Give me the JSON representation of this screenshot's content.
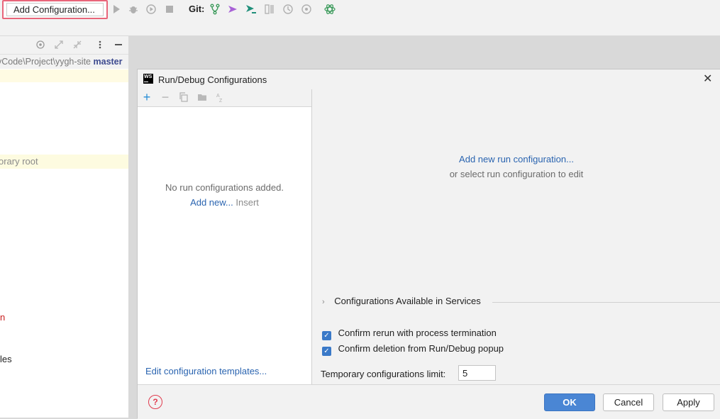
{
  "toolbar": {
    "add_configuration_label": "Add Configuration...",
    "git_label": "Git:"
  },
  "project_panel": {
    "path_prefix": "yCode\\Project\\yygh-site",
    "branch": "master",
    "highlight_text": "orary root",
    "row_text": "les",
    "red_text": "n"
  },
  "dialog": {
    "title": "Run/Debug Configurations",
    "logo_text": "WS",
    "close_label": "✕",
    "list": {
      "empty_text": "No run configurations added.",
      "add_new_link": "Add new...",
      "add_new_hint": "Insert",
      "edit_templates_link": "Edit configuration templates..."
    },
    "details": {
      "add_run_link": "Add new run configuration...",
      "or_select_text": "or select run configuration to edit",
      "services_label": "Configurations Available in Services",
      "confirm_rerun_label": "Confirm rerun with process termination",
      "confirm_deletion_label": "Confirm deletion from Run/Debug popup",
      "temp_limit_label": "Temporary configurations limit:",
      "temp_limit_value": "5"
    },
    "buttons": {
      "ok": "OK",
      "cancel": "Cancel",
      "apply": "Apply",
      "help": "?"
    }
  },
  "colors": {
    "accent": "#4a86d4",
    "link": "#2a64b0",
    "highlight_border": "#e8657a"
  }
}
